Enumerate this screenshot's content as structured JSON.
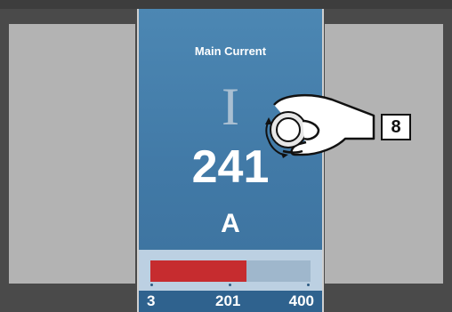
{
  "display": {
    "title": "Main Current",
    "symbol": "I",
    "value": "241",
    "unit": "A"
  },
  "gauge": {
    "min_label": "3",
    "mid_label": "201",
    "max_label": "400",
    "level_percent": 60,
    "fill_color": "#c62c2f"
  },
  "annotation": {
    "step_number": "8",
    "gesture": "rotary-knob-turn-icon"
  },
  "colors": {
    "display_background": "#4179a6",
    "scale_background": "#2f628e"
  }
}
